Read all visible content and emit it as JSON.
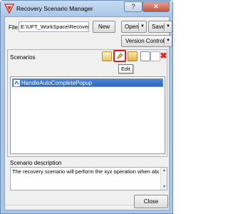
{
  "window": {
    "title": "Recovery Scenario Manager",
    "help_label": "?",
    "close_label": "✕"
  },
  "file": {
    "label": "File:",
    "value": "E:\\UFT_WorkSpace\\Recovery"
  },
  "buttons": {
    "new": "New",
    "open": "Open",
    "save": "Save",
    "version_control": "Version Control",
    "close": "Close"
  },
  "scenarios": {
    "label": "Scenarios",
    "tooltip": "Edit",
    "items": [
      {
        "label": "HandleAutoCompletePopup"
      }
    ]
  },
  "description": {
    "label": "Scenario description",
    "text": "The recovery scenario will perform the xyz operation when abcd windo"
  },
  "colors": {
    "selection": "#3874c8",
    "highlight_border": "#e02020"
  }
}
